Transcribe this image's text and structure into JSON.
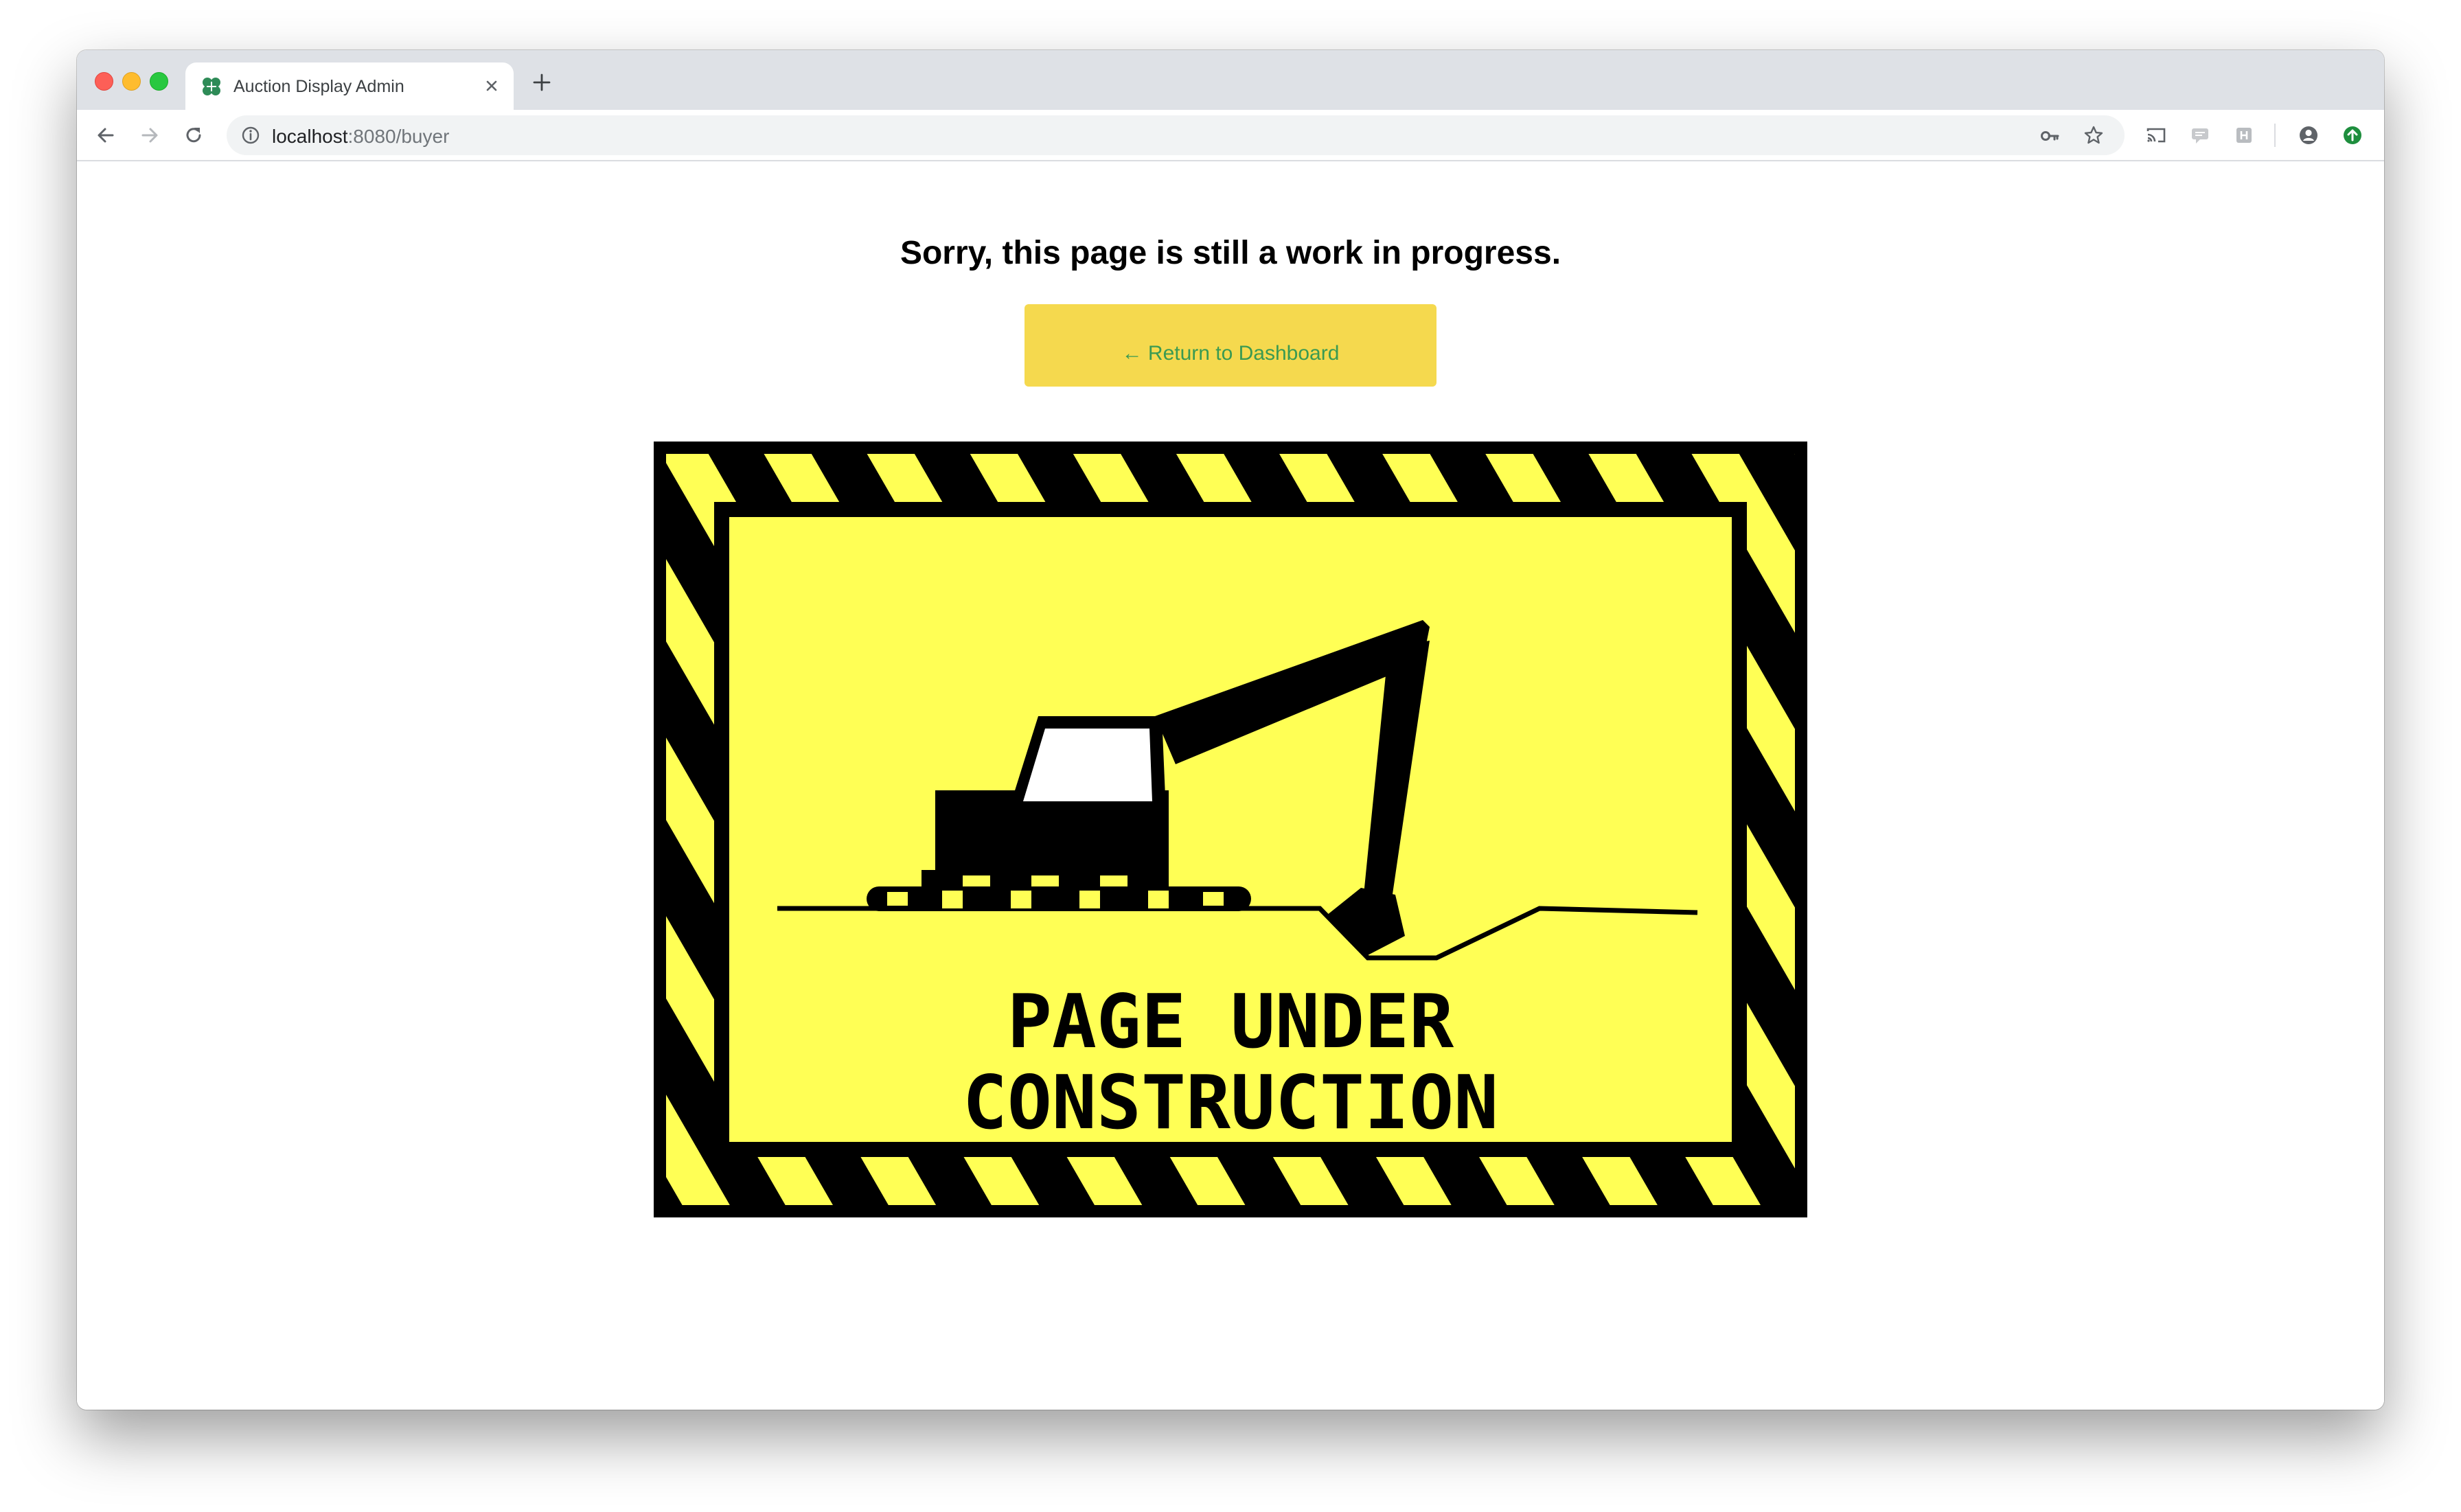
{
  "browser": {
    "tab": {
      "title": "Auction Display Admin",
      "favicon_icon": "four-leaf-clover-icon"
    },
    "address_bar": {
      "host": "localhost",
      "rest": ":8080/buyer"
    }
  },
  "page": {
    "heading": "Sorry, this page is still a work in progress.",
    "return_button_label": "← Return to Dashboard",
    "image": {
      "line1": "PAGE UNDER",
      "line2": "CONSTRUCTION"
    }
  },
  "colors": {
    "button_bg": "#f5d94e",
    "button_text": "#3a9a52",
    "sign_yellow": "#ffff55",
    "favicon_green": "#2e8b57"
  }
}
